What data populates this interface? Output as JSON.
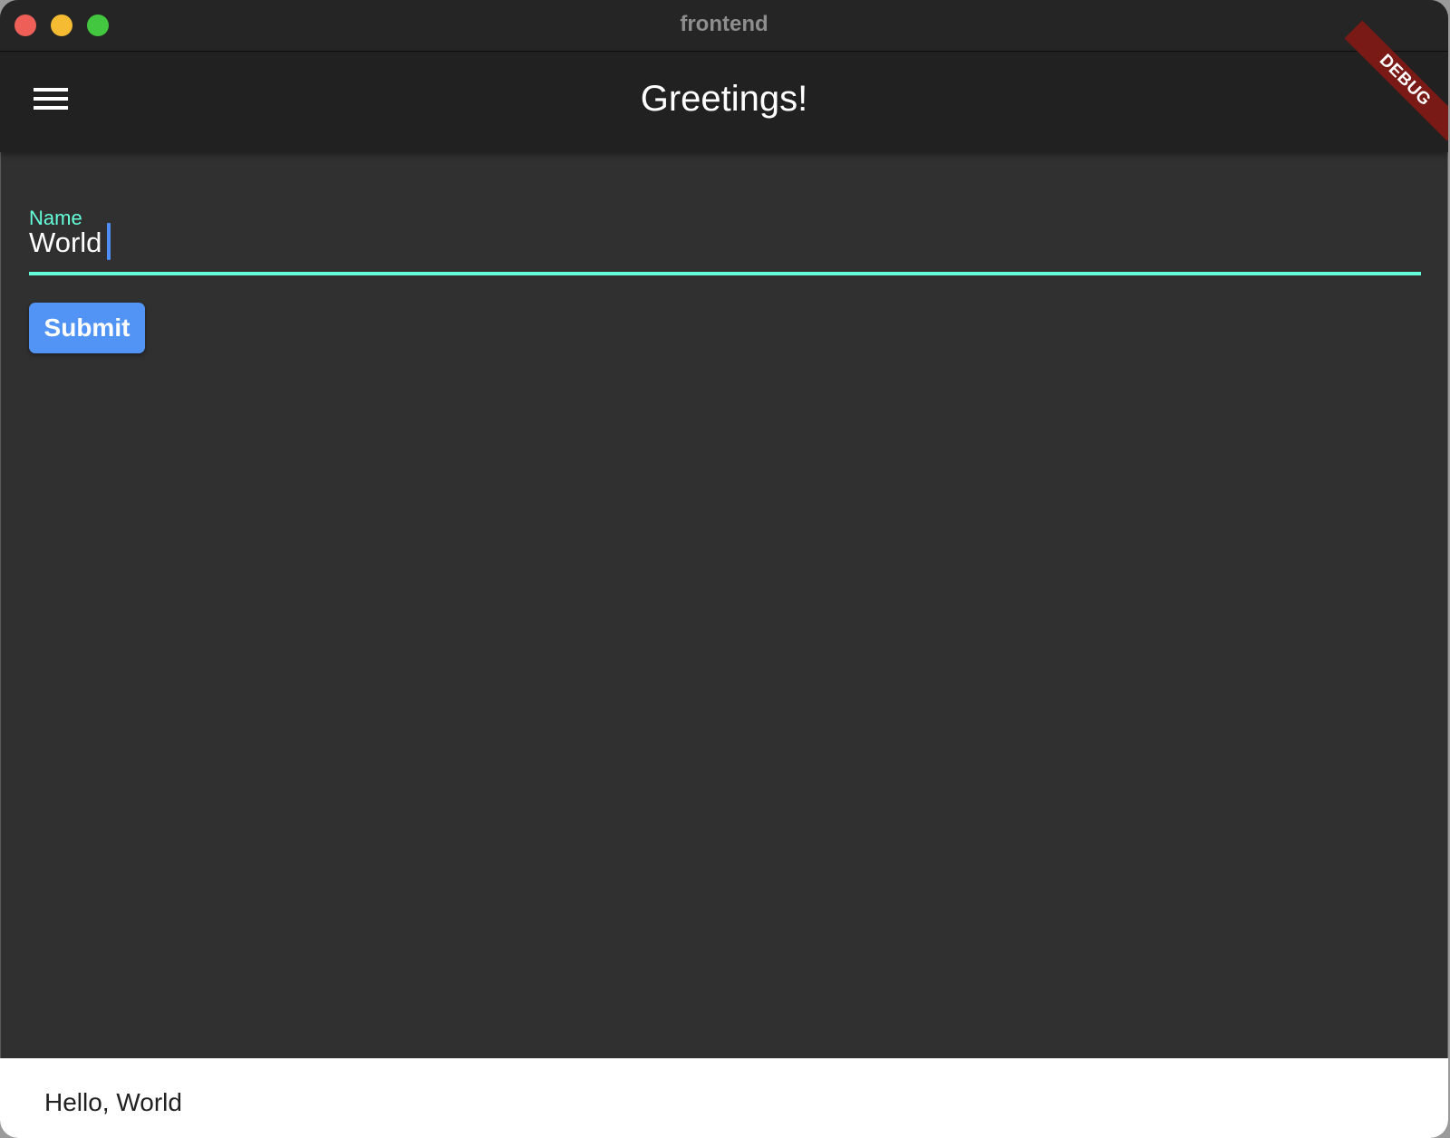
{
  "window": {
    "title": "frontend",
    "controls": [
      "close",
      "minimize",
      "maximize"
    ]
  },
  "appbar": {
    "title": "Greetings!",
    "menu_icon": "hamburger-menu-icon",
    "debug_banner": "DEBUG"
  },
  "form": {
    "name_field": {
      "label": "Name",
      "value": "World"
    },
    "submit_label": "Submit"
  },
  "snackbar": {
    "message": "Hello, World"
  },
  "colors": {
    "accent": "#64ffda",
    "button": "#5294f5",
    "appbar": "#212121",
    "background": "#303030",
    "debug_banner": "#7a1a17"
  }
}
